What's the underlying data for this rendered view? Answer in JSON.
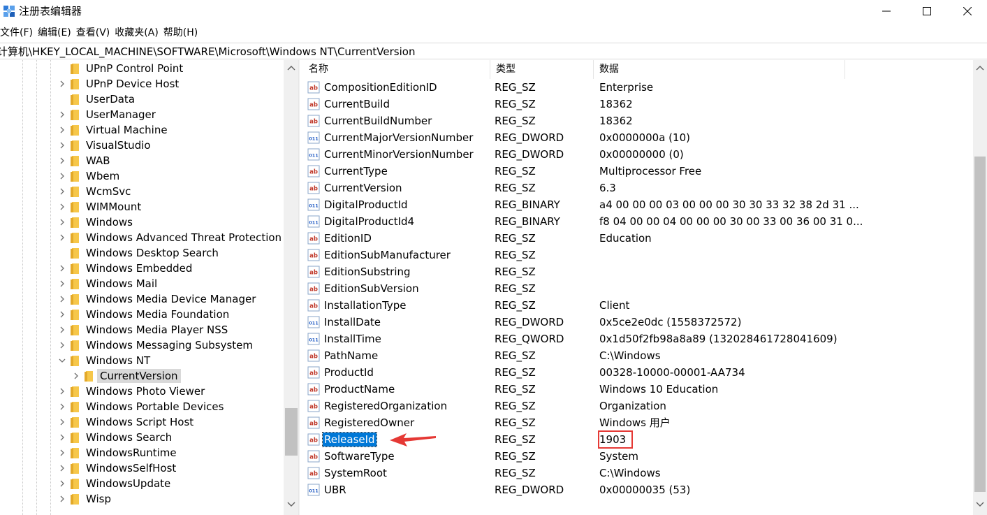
{
  "window": {
    "title": "注册表编辑器",
    "minimize_label": "minimize",
    "maximize_label": "maximize",
    "close_label": "close"
  },
  "menu": [
    "文件(F)",
    "编辑(E)",
    "查看(V)",
    "收藏夹(A)",
    "帮助(H)"
  ],
  "address": "计算机\\HKEY_LOCAL_MACHINE\\SOFTWARE\\Microsoft\\Windows NT\\CurrentVersion",
  "tree": {
    "items": [
      {
        "label": "UPnP Control Point",
        "expandable": false
      },
      {
        "label": "UPnP Device Host",
        "expandable": true
      },
      {
        "label": "UserData",
        "expandable": false
      },
      {
        "label": "UserManager",
        "expandable": true
      },
      {
        "label": "Virtual Machine",
        "expandable": true
      },
      {
        "label": "VisualStudio",
        "expandable": true
      },
      {
        "label": "WAB",
        "expandable": true
      },
      {
        "label": "Wbem",
        "expandable": true
      },
      {
        "label": "WcmSvc",
        "expandable": true
      },
      {
        "label": "WIMMount",
        "expandable": true
      },
      {
        "label": "Windows",
        "expandable": true
      },
      {
        "label": "Windows Advanced Threat Protection",
        "expandable": true
      },
      {
        "label": "Windows Desktop Search",
        "expandable": false
      },
      {
        "label": "Windows Embedded",
        "expandable": true
      },
      {
        "label": "Windows Mail",
        "expandable": true
      },
      {
        "label": "Windows Media Device Manager",
        "expandable": true
      },
      {
        "label": "Windows Media Foundation",
        "expandable": true
      },
      {
        "label": "Windows Media Player NSS",
        "expandable": true
      },
      {
        "label": "Windows Messaging Subsystem",
        "expandable": true
      },
      {
        "label": "Windows NT",
        "expandable": true,
        "expanded": true
      },
      {
        "label": "CurrentVersion",
        "expandable": true,
        "child": true,
        "selected": true
      },
      {
        "label": "Windows Photo Viewer",
        "expandable": true
      },
      {
        "label": "Windows Portable Devices",
        "expandable": true
      },
      {
        "label": "Windows Script Host",
        "expandable": true
      },
      {
        "label": "Windows Search",
        "expandable": true
      },
      {
        "label": "WindowsRuntime",
        "expandable": true
      },
      {
        "label": "WindowsSelfHost",
        "expandable": true
      },
      {
        "label": "WindowsUpdate",
        "expandable": true
      },
      {
        "label": "Wisp",
        "expandable": true
      }
    ]
  },
  "list": {
    "columns": [
      "名称",
      "类型",
      "数据"
    ],
    "rows": [
      {
        "icon": "string-value-icon",
        "name": "CompositionEditionID",
        "type": "REG_SZ",
        "data": "Enterprise"
      },
      {
        "icon": "string-value-icon",
        "name": "CurrentBuild",
        "type": "REG_SZ",
        "data": "18362"
      },
      {
        "icon": "string-value-icon",
        "name": "CurrentBuildNumber",
        "type": "REG_SZ",
        "data": "18362"
      },
      {
        "icon": "binary-value-icon",
        "name": "CurrentMajorVersionNumber",
        "type": "REG_DWORD",
        "data": "0x0000000a (10)"
      },
      {
        "icon": "binary-value-icon",
        "name": "CurrentMinorVersionNumber",
        "type": "REG_DWORD",
        "data": "0x00000000 (0)"
      },
      {
        "icon": "string-value-icon",
        "name": "CurrentType",
        "type": "REG_SZ",
        "data": "Multiprocessor Free"
      },
      {
        "icon": "string-value-icon",
        "name": "CurrentVersion",
        "type": "REG_SZ",
        "data": "6.3"
      },
      {
        "icon": "binary-value-icon",
        "name": "DigitalProductId",
        "type": "REG_BINARY",
        "data": "a4 00 00 00 03 00 00 00 30 30 33 32 38 2d 31 ..."
      },
      {
        "icon": "binary-value-icon",
        "name": "DigitalProductId4",
        "type": "REG_BINARY",
        "data": "f8 04 00 00 04 00 00 00 30 00 33 00 36 00 31 0..."
      },
      {
        "icon": "string-value-icon",
        "name": "EditionID",
        "type": "REG_SZ",
        "data": "Education"
      },
      {
        "icon": "string-value-icon",
        "name": "EditionSubManufacturer",
        "type": "REG_SZ",
        "data": ""
      },
      {
        "icon": "string-value-icon",
        "name": "EditionSubstring",
        "type": "REG_SZ",
        "data": ""
      },
      {
        "icon": "string-value-icon",
        "name": "EditionSubVersion",
        "type": "REG_SZ",
        "data": ""
      },
      {
        "icon": "string-value-icon",
        "name": "InstallationType",
        "type": "REG_SZ",
        "data": "Client"
      },
      {
        "icon": "binary-value-icon",
        "name": "InstallDate",
        "type": "REG_DWORD",
        "data": "0x5ce2e0dc (1558372572)"
      },
      {
        "icon": "binary-value-icon",
        "name": "InstallTime",
        "type": "REG_QWORD",
        "data": "0x1d50f2fb98a8a89 (132028461728041609)"
      },
      {
        "icon": "string-value-icon",
        "name": "PathName",
        "type": "REG_SZ",
        "data": "C:\\Windows"
      },
      {
        "icon": "string-value-icon",
        "name": "ProductId",
        "type": "REG_SZ",
        "data": "00328-10000-00001-AA734"
      },
      {
        "icon": "string-value-icon",
        "name": "ProductName",
        "type": "REG_SZ",
        "data": "Windows 10 Education"
      },
      {
        "icon": "string-value-icon",
        "name": "RegisteredOrganization",
        "type": "REG_SZ",
        "data": "Organization"
      },
      {
        "icon": "string-value-icon",
        "name": "RegisteredOwner",
        "type": "REG_SZ",
        "data": "Windows 用户"
      },
      {
        "icon": "string-value-icon",
        "name": "ReleaseId",
        "type": "REG_SZ",
        "data": "1903",
        "selected": true,
        "highlighted": true
      },
      {
        "icon": "string-value-icon",
        "name": "SoftwareType",
        "type": "REG_SZ",
        "data": "System"
      },
      {
        "icon": "string-value-icon",
        "name": "SystemRoot",
        "type": "REG_SZ",
        "data": "C:\\Windows"
      },
      {
        "icon": "binary-value-icon",
        "name": "UBR",
        "type": "REG_DWORD",
        "data": "0x00000035 (53)"
      }
    ]
  },
  "colors": {
    "selection": "#0078d7",
    "annotation": "#e53935",
    "folder": "#f6c74a",
    "string_icon": "#c0392b",
    "binary_icon": "#2b63c7"
  },
  "icons": {
    "app": "registry-editor-icon",
    "folder": "folder-icon",
    "string": "string-value-icon",
    "binary": "binary-value-icon",
    "annotation": "red-arrow-icon"
  }
}
